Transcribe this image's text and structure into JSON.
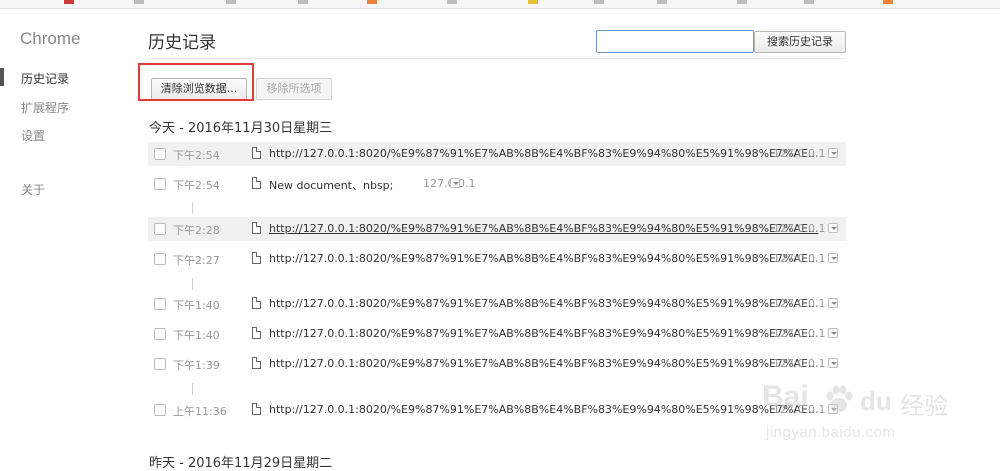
{
  "sidebar": {
    "brand": "Chrome",
    "items": [
      {
        "label": "历史记录",
        "selected": true
      },
      {
        "label": "扩展程序",
        "selected": false
      },
      {
        "label": "设置",
        "selected": false
      },
      {
        "label": "关于",
        "selected": false
      }
    ]
  },
  "header": {
    "title": "历史记录",
    "search_placeholder": "",
    "search_button": "搜索历史记录"
  },
  "toolbar": {
    "clear_button": "清除浏览数据...",
    "remove_button": "移除所选项"
  },
  "days": [
    {
      "heading": "今天 - 2016年11月30日星期三",
      "entries": [
        {
          "time": "下午2:54",
          "title": "http://127.0.0.1:8020/%E9%87%91%E7%AB%8B%E4%BF%83%E9%94%80%E5%91%98%E7%AE...",
          "domain": "127.0.0.1"
        },
        {
          "time": "下午2:54",
          "title": "New document、nbsp;",
          "domain": "127.0.0.1"
        },
        {
          "time": "下午2:28",
          "title": "http://127.0.0.1:8020/%E9%87%91%E7%AB%8B%E4%BF%83%E9%94%80%E5%91%98%E7%AE...",
          "domain": "127.0.0.1"
        },
        {
          "time": "下午2:27",
          "title": "http://127.0.0.1:8020/%E9%87%91%E7%AB%8B%E4%BF%83%E9%94%80%E5%91%98%E7%AE...",
          "domain": "127.0.0.1"
        },
        {
          "time": "下午1:40",
          "title": "http://127.0.0.1:8020/%E9%87%91%E7%AB%8B%E4%BF%83%E9%94%80%E5%91%98%E7%AE...",
          "domain": "127.0.0.1"
        },
        {
          "time": "下午1:40",
          "title": "http://127.0.0.1:8020/%E9%87%91%E7%AB%8B%E4%BF%83%E9%94%80%E5%91%98%E7%AE...",
          "domain": "127.0.0.1"
        },
        {
          "time": "下午1:39",
          "title": "http://127.0.0.1:8020/%E9%87%91%E7%AB%8B%E4%BF%83%E9%94%80%E5%91%98%E7%AE...",
          "domain": "127.0.0.1"
        },
        {
          "time": "上午11:36",
          "title": "http://127.0.0.1:8020/%E9%87%91%E7%AB%8B%E4%BF%83%E9%94%80%E5%91%98%E7%AE...",
          "domain": "127.0.0.1"
        }
      ]
    },
    {
      "heading": "昨天 - 2016年11月29日星期二",
      "entries": []
    }
  ],
  "watermark": {
    "brand_left": "Bai",
    "brand_right": "du",
    "brand_cn": "经验",
    "url": "jingyan.baidu.com"
  },
  "colors": {
    "highlight": "#e03b3b",
    "selected_nav": "#333333"
  }
}
